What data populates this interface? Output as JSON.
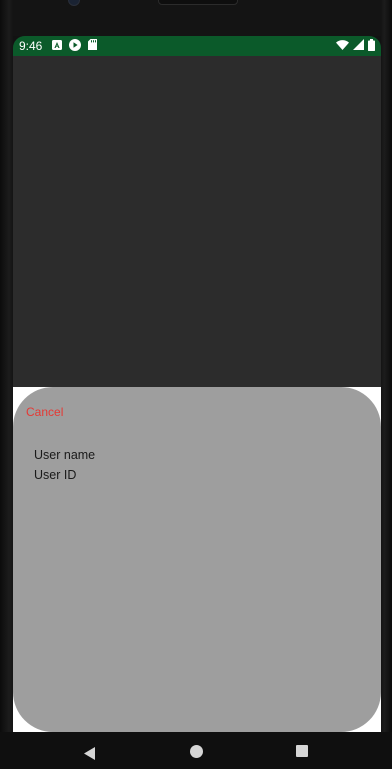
{
  "status_bar": {
    "time": "9:46",
    "left_icons": [
      "a-notification-icon",
      "play-store-icon",
      "sd-card-icon"
    ],
    "right_icons": [
      "wifi-icon",
      "cell-signal-icon",
      "battery-icon"
    ],
    "background_color": "#0b5a2a"
  },
  "bottom_sheet": {
    "cancel_label": "Cancel",
    "items": [
      {
        "label": "User name"
      },
      {
        "label": "User ID"
      }
    ],
    "background_color": "#9e9e9e",
    "cancel_color": "#e53935"
  },
  "navigation_bar": {
    "buttons": [
      "back-icon",
      "home-icon",
      "recents-icon"
    ]
  }
}
